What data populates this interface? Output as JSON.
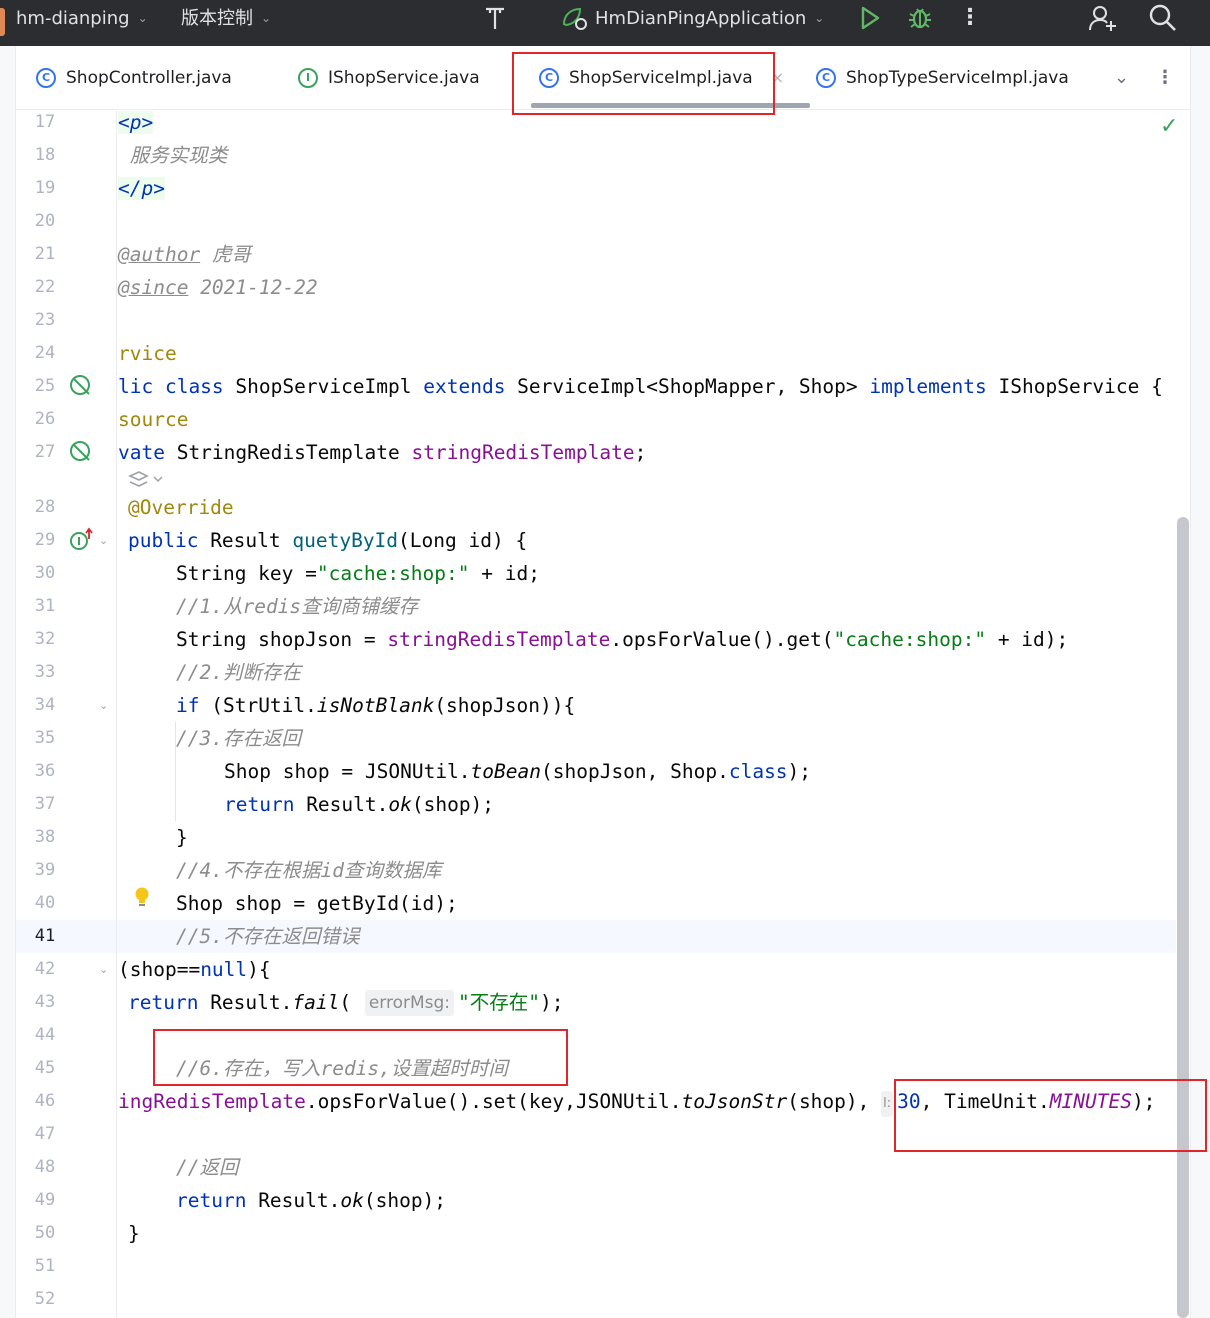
{
  "titlebar": {
    "project": "hm-dianping",
    "vcs": "版本控制",
    "run_config": "HmDianPingApplication"
  },
  "tabs": [
    {
      "label": "ShopController.java",
      "icon": "class-icon"
    },
    {
      "label": "IShopService.java",
      "icon": "interface-icon"
    },
    {
      "label": "ShopServiceImpl.java",
      "icon": "class-icon",
      "active": true
    },
    {
      "label": "ShopTypeServiceImpl.java",
      "icon": "class-icon"
    }
  ],
  "tab_close": "×",
  "editor": {
    "current_line": "41",
    "lines": [
      {
        "n": "17",
        "tokens": [
          {
            "t": "<p>",
            "c": "tag"
          }
        ]
      },
      {
        "n": "18",
        "tokens": [
          {
            "t": " 服务实现类",
            "c": "c"
          }
        ]
      },
      {
        "n": "19",
        "tokens": [
          {
            "t": "</p>",
            "c": "tag"
          }
        ]
      },
      {
        "n": "20",
        "tokens": []
      },
      {
        "n": "21",
        "tokens": [
          {
            "t": "@author",
            "c": "dt"
          },
          {
            "t": " 虎哥",
            "c": "c"
          }
        ]
      },
      {
        "n": "22",
        "tokens": [
          {
            "t": "@since",
            "c": "dt"
          },
          {
            "t": " 2021-12-22",
            "c": "c"
          }
        ]
      },
      {
        "n": "23",
        "tokens": []
      },
      {
        "n": "24",
        "tokens": [
          {
            "t": "rvice",
            "c": "an"
          }
        ]
      },
      {
        "n": "25",
        "tokens": [
          {
            "t": "lic class ",
            "c": "k"
          },
          {
            "t": "ShopServiceImpl ",
            "c": ""
          },
          {
            "t": "extends ",
            "c": "k"
          },
          {
            "t": "ServiceImpl<ShopMapper, Shop> ",
            "c": ""
          },
          {
            "t": "implements ",
            "c": "k"
          },
          {
            "t": "IShopService {",
            "c": ""
          }
        ]
      },
      {
        "n": "26",
        "tokens": [
          {
            "t": "source",
            "c": "an"
          }
        ]
      },
      {
        "n": "27",
        "tokens": [
          {
            "t": "vate ",
            "c": "k"
          },
          {
            "t": "StringRedisTemplate ",
            "c": ""
          },
          {
            "t": "stringRedisTemplate",
            "c": "fl"
          },
          {
            "t": ";",
            "c": ""
          }
        ]
      },
      {
        "n": "28",
        "tokens": [
          {
            "t": "@Override",
            "c": "an"
          }
        ]
      },
      {
        "n": "29",
        "tokens": [
          {
            "t": "public ",
            "c": "k"
          },
          {
            "t": "Result ",
            "c": ""
          },
          {
            "t": "quetyById",
            "c": "f"
          },
          {
            "t": "(Long id) {",
            "c": ""
          }
        ]
      },
      {
        "n": "30",
        "tokens": [
          {
            "t": "String key =",
            "c": ""
          },
          {
            "t": "\"cache:shop:\"",
            "c": "s"
          },
          {
            "t": " + id;",
            "c": ""
          }
        ]
      },
      {
        "n": "31",
        "tokens": [
          {
            "t": "//1.从redis查询商铺缓存",
            "c": "c"
          }
        ]
      },
      {
        "n": "32",
        "tokens": [
          {
            "t": "String shopJson = ",
            "c": ""
          },
          {
            "t": "stringRedisTemplate",
            "c": "fl"
          },
          {
            "t": ".opsForValue().get(",
            "c": ""
          },
          {
            "t": "\"cache:shop:\"",
            "c": "s"
          },
          {
            "t": " + id);",
            "c": ""
          }
        ]
      },
      {
        "n": "33",
        "tokens": [
          {
            "t": "//2.判断存在",
            "c": "c"
          }
        ]
      },
      {
        "n": "34",
        "tokens": [
          {
            "t": "if ",
            "c": "k"
          },
          {
            "t": "(StrUtil.",
            "c": ""
          },
          {
            "t": "isNotBlank",
            "c": "it"
          },
          {
            "t": "(shopJson)){",
            "c": ""
          }
        ]
      },
      {
        "n": "35",
        "tokens": [
          {
            "t": "//3.存在返回",
            "c": "c"
          }
        ]
      },
      {
        "n": "36",
        "tokens": [
          {
            "t": "Shop shop = JSONUtil.",
            "c": ""
          },
          {
            "t": "toBean",
            "c": "it"
          },
          {
            "t": "(shopJson, Shop.",
            "c": ""
          },
          {
            "t": "class",
            "c": "k"
          },
          {
            "t": ");",
            "c": ""
          }
        ]
      },
      {
        "n": "37",
        "tokens": [
          {
            "t": "return ",
            "c": "k"
          },
          {
            "t": "Result.",
            "c": ""
          },
          {
            "t": "ok",
            "c": "it"
          },
          {
            "t": "(shop);",
            "c": ""
          }
        ]
      },
      {
        "n": "38",
        "tokens": [
          {
            "t": "}",
            "c": ""
          }
        ]
      },
      {
        "n": "39",
        "tokens": [
          {
            "t": "//4.不存在根据id查询数据库",
            "c": "c"
          }
        ]
      },
      {
        "n": "40",
        "tokens": [
          {
            "t": "Shop shop = getById(id);",
            "c": ""
          }
        ]
      },
      {
        "n": "41",
        "tokens": [
          {
            "t": "//5.不存在返回错误",
            "c": "c"
          }
        ]
      },
      {
        "n": "42",
        "tokens": [
          {
            "t": "(shop==",
            "c": ""
          },
          {
            "t": "null",
            "c": "k"
          },
          {
            "t": "){",
            "c": ""
          }
        ]
      },
      {
        "n": "43",
        "tokens": [
          {
            "t": "return ",
            "c": "k"
          },
          {
            "t": "Result.",
            "c": ""
          },
          {
            "t": "fail",
            "c": "it"
          },
          {
            "t": "( ",
            "c": ""
          },
          {
            "t": "errorMsg:",
            "c": "hint"
          },
          {
            "t": "\"不存在\"",
            "c": "s"
          },
          {
            "t": ");",
            "c": ""
          }
        ]
      },
      {
        "n": "44",
        "tokens": []
      },
      {
        "n": "45",
        "tokens": [
          {
            "t": "//6.存在，写入redis,设置超时时间",
            "c": "c"
          }
        ]
      },
      {
        "n": "46",
        "tokens": [
          {
            "t": "ingRedisTemplate",
            "c": "fl"
          },
          {
            "t": ".opsForValue().set(key,JSONUtil.",
            "c": ""
          },
          {
            "t": "toJsonStr",
            "c": "it"
          },
          {
            "t": "(shop), ",
            "c": ""
          },
          {
            "t": "l:",
            "c": "hint small"
          },
          {
            "t": "30",
            "c": "k"
          },
          {
            "t": ", TimeUnit.",
            "c": ""
          },
          {
            "t": "MINUTES",
            "c": "const"
          },
          {
            "t": ");",
            "c": ""
          }
        ]
      },
      {
        "n": "47",
        "tokens": []
      },
      {
        "n": "48",
        "tokens": [
          {
            "t": "//返回",
            "c": "c"
          }
        ]
      },
      {
        "n": "49",
        "tokens": [
          {
            "t": "return ",
            "c": "k"
          },
          {
            "t": "Result.",
            "c": ""
          },
          {
            "t": "ok",
            "c": "it"
          },
          {
            "t": "(shop);",
            "c": ""
          }
        ]
      },
      {
        "n": "50",
        "tokens": [
          {
            "t": "}",
            "c": ""
          }
        ]
      },
      {
        "n": "51",
        "tokens": []
      },
      {
        "n": "52",
        "tokens": []
      }
    ]
  },
  "colors": {
    "keyword": "#0033b3",
    "string": "#067d17",
    "method": "#00627a",
    "field": "#871094",
    "comment": "#8c8c8c",
    "annotation": "#9e880d",
    "highlight_box": "#e0262b"
  }
}
